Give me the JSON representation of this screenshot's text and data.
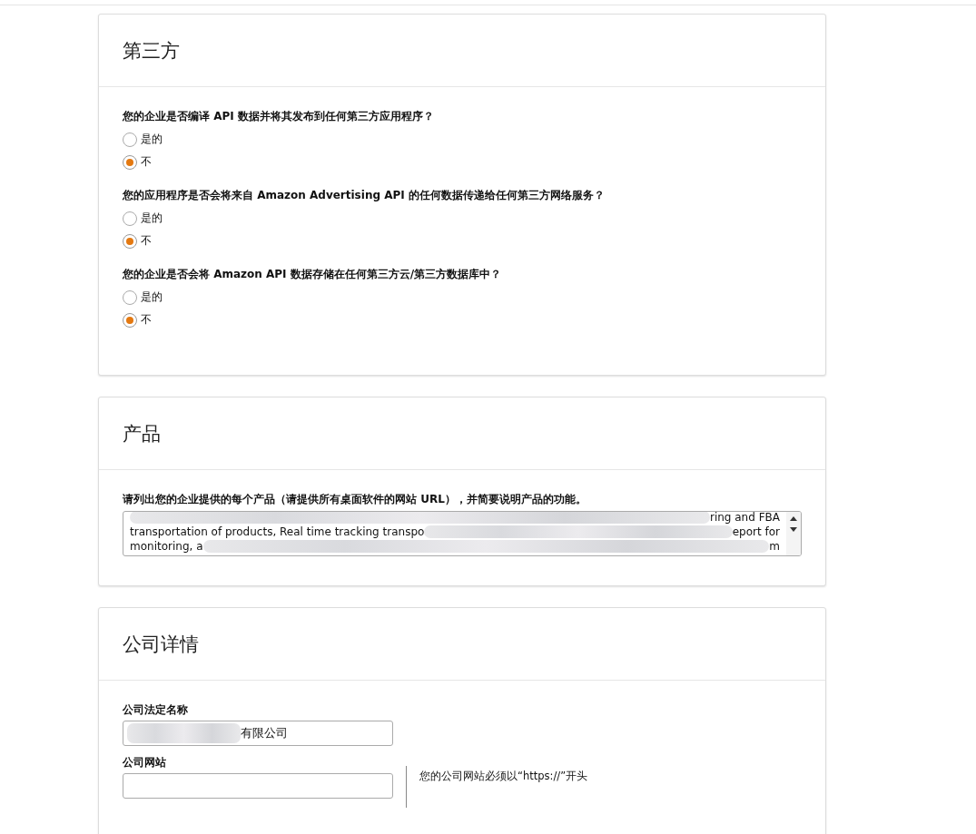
{
  "sections": [
    {
      "title": "第三方",
      "kind": "questions",
      "questions": [
        {
          "label": "您的企业是否编译 API 数据并将其发布到任何第三方应用程序？",
          "options": [
            {
              "label": "是的",
              "selected": false
            },
            {
              "label": "不",
              "selected": true
            }
          ]
        },
        {
          "label": "您的应用程序是否会将来自 Amazon Advertising API 的任何数据传递给任何第三方网络服务？",
          "options": [
            {
              "label": "是的",
              "selected": false
            },
            {
              "label": "不",
              "selected": true
            }
          ]
        },
        {
          "label": "您的企业是否会将 Amazon API 数据存储在任何第三方云/第三方数据库中？",
          "options": [
            {
              "label": "是的",
              "selected": false
            },
            {
              "label": "不",
              "selected": true
            }
          ]
        }
      ]
    },
    {
      "title": "产品",
      "kind": "textarea",
      "label": "请列出您的企业提供的每个产品（请提供所有桌面软件的网站 URL），并简要说明产品的功能。",
      "lines": [
        {
          "right": "ring and FBA"
        },
        {
          "left": "transportation of products, Real time tracking transpo",
          "right": "eport for"
        },
        {
          "left": "monitoring, a",
          "right": "m"
        }
      ]
    },
    {
      "title": "公司详情",
      "kind": "company",
      "fields": [
        {
          "label": "公司法定名称",
          "value": "有限公司",
          "redacted": true
        },
        {
          "label": "公司网站",
          "hint": "您的公司网站必须以“https://”开头"
        }
      ]
    }
  ]
}
